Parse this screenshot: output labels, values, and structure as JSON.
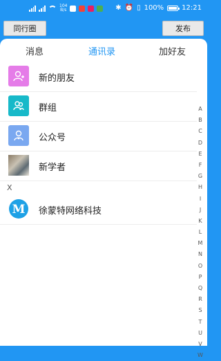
{
  "status": {
    "speed_value": "104",
    "speed_unit": "B/s",
    "battery": "100%",
    "time": "12:21"
  },
  "header": {
    "left_button": "同行圈",
    "right_button": "发布"
  },
  "tabs": [
    "消息",
    "通讯录",
    "加好友"
  ],
  "contacts": {
    "fixed": [
      "新的朋友",
      "群组",
      "公众号",
      "新学者"
    ],
    "section_letter": "X",
    "section_items": [
      "徐蒙特网络科技"
    ]
  },
  "alphabet": [
    "A",
    "B",
    "C",
    "D",
    "E",
    "F",
    "G",
    "H",
    "I",
    "J",
    "K",
    "L",
    "M",
    "N",
    "O",
    "P",
    "Q",
    "R",
    "S",
    "T",
    "U",
    "V",
    "W"
  ],
  "colors": {
    "primary": "#2196F3",
    "new_friend": "#E57CE8",
    "group": "#17B9C9",
    "public": "#7AA8F0"
  }
}
